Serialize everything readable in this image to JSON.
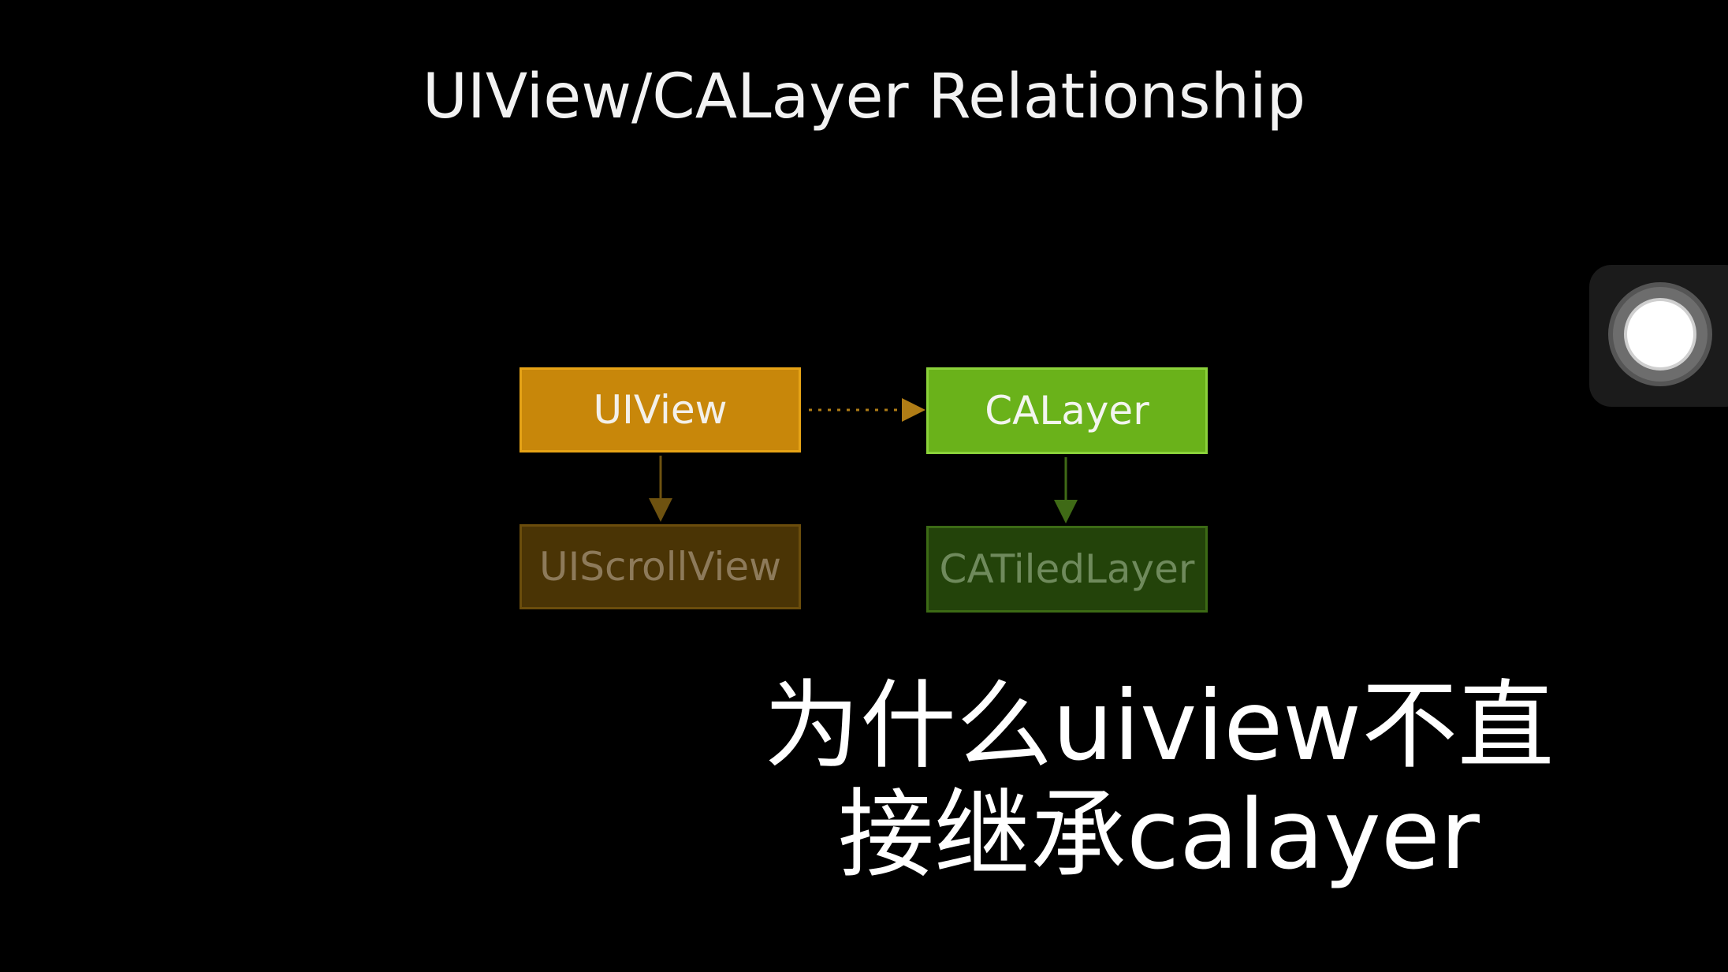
{
  "slide": {
    "title": "UIView/CALayer Relationship"
  },
  "diagram": {
    "nodes": {
      "uiview": "UIView",
      "calayer": "CALayer",
      "uiscrollview": "UIScrollView",
      "catiledlayer": "CATiledLayer"
    },
    "edges": [
      {
        "from": "UIView",
        "to": "CALayer",
        "style": "dotted"
      },
      {
        "from": "UIView",
        "to": "UIScrollView",
        "style": "solid"
      },
      {
        "from": "CALayer",
        "to": "CATiledLayer",
        "style": "solid"
      }
    ],
    "colors": {
      "uiview": "#c8870a",
      "calayer": "#6ab21a",
      "uiscrollview": "#4a3405",
      "catiledlayer": "#23430a",
      "background": "#000000"
    }
  },
  "subtitle": {
    "line1": "为什么uiview不直",
    "line2": "接继承calayer"
  },
  "assistive_touch": {
    "icon": "assistive-touch-icon"
  }
}
